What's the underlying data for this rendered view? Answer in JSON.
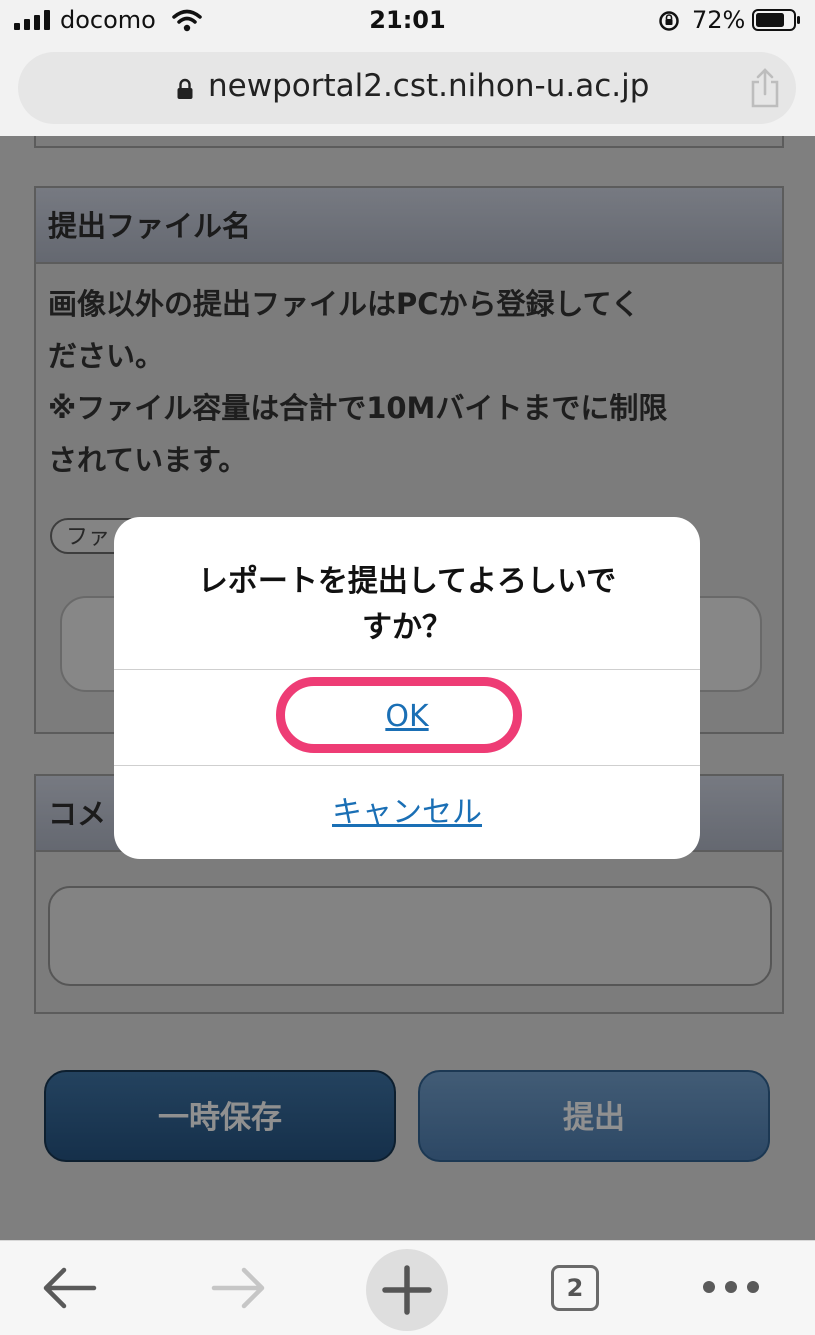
{
  "status_bar": {
    "carrier": "docomo",
    "time": "21:01",
    "battery_percent": "72%",
    "icons": [
      "signal-icon",
      "wifi-icon",
      "rotation-lock-icon",
      "battery-icon"
    ]
  },
  "address_bar": {
    "url": "newportal2.cst.nihon-u.ac.jp",
    "icons": [
      "lock-icon",
      "share-icon"
    ]
  },
  "page": {
    "file_section": {
      "header": "提出ファイル名",
      "notice_lines": [
        "画像以外の提出ファイルはPCから登録してく",
        "ださい。",
        "※ファイル容量は合計で10Mバイトまでに制限",
        "されています。"
      ],
      "file_button_partial": "ファ"
    },
    "comment_section": {
      "header_partial": "コメ"
    },
    "buttons": {
      "save": "一時保存",
      "submit": "提出"
    }
  },
  "dialog": {
    "message_line1": "レポートを提出してよろしいで",
    "message_line2": "すか？",
    "ok_label": "OK",
    "cancel_label": "キャンセル",
    "highlight_color": "#ee3c75"
  },
  "toolbar": {
    "tab_count": "2",
    "icons": [
      "back-arrow-icon",
      "forward-arrow-icon",
      "new-tab-plus-icon",
      "tabs-icon",
      "more-icon"
    ]
  }
}
